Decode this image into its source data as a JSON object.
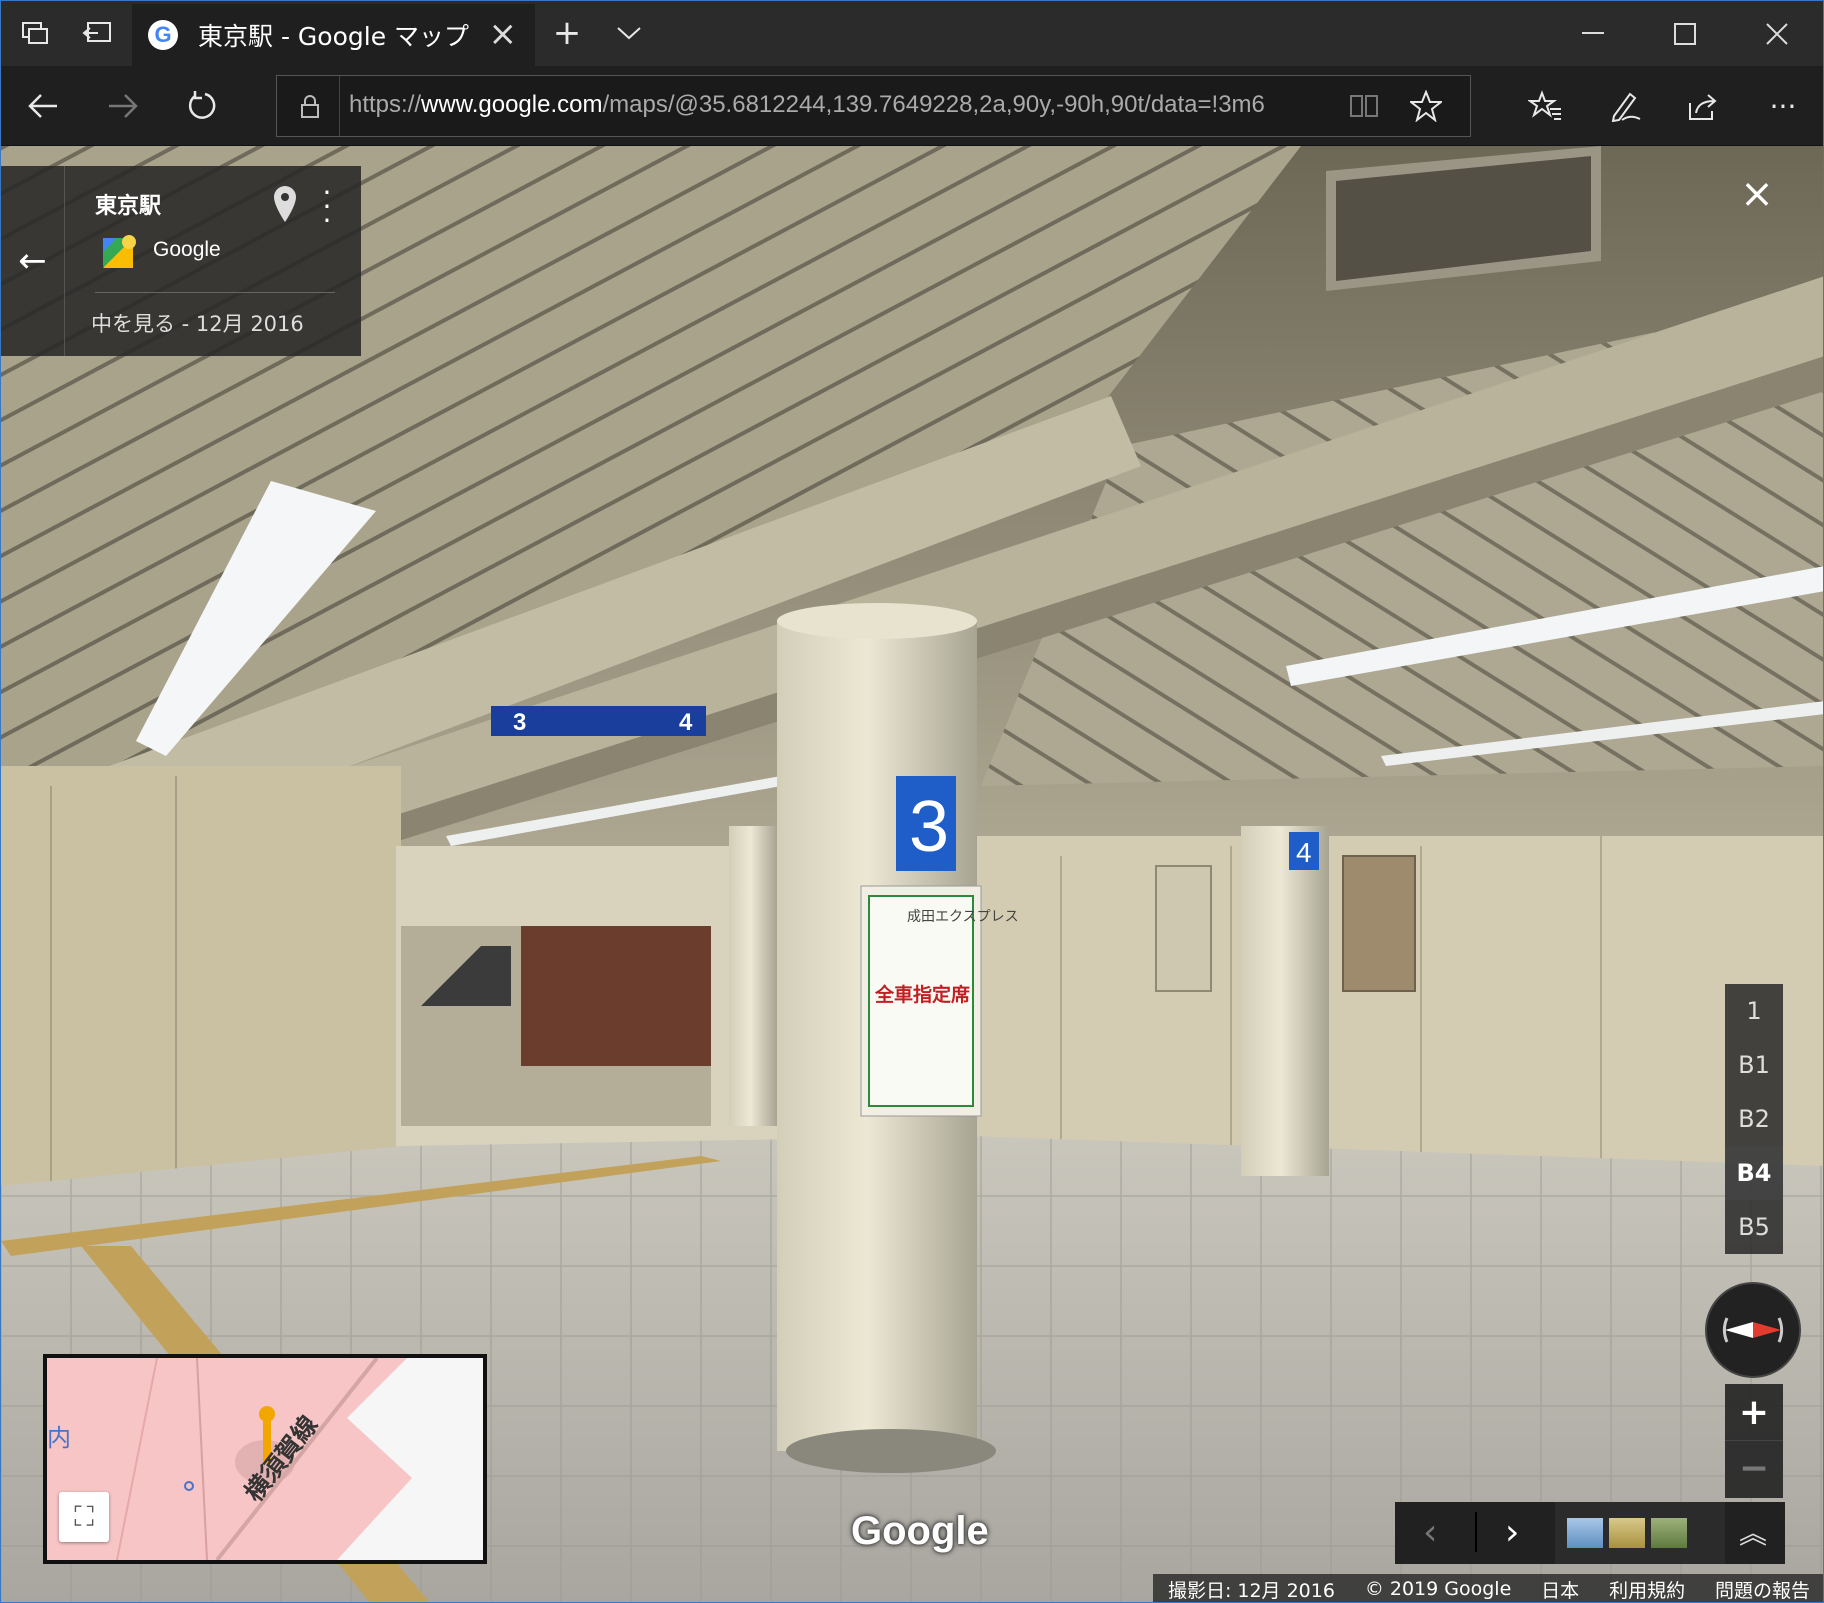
{
  "tab": {
    "title": "東京駅 - Google マップ"
  },
  "address": {
    "scheme": "https://",
    "host": "www.google.com",
    "path": "/maps/@35.6812244,139.7649228,2a,90y,-90h,90t/data=!3m6"
  },
  "card": {
    "title": "東京駅",
    "source": "Google",
    "date": "中を見る - 12月 2016"
  },
  "floors": [
    "1",
    "B1",
    "B2",
    "B4",
    "B5"
  ],
  "active_floor": "B4",
  "zoom": {
    "in": "+",
    "out": "−"
  },
  "minimap": {
    "kanji": "内",
    "rail_label": "横須賀線"
  },
  "logo": "Google",
  "footer": {
    "date": "撮影日: 12月 2016",
    "copyright": "© 2019 Google",
    "region": "日本",
    "terms": "利用規約",
    "report": "問題の報告"
  },
  "scene": {
    "pillar_3": "3",
    "pillar_4": "4",
    "sign_left": "3",
    "sign_right": "4",
    "poster_title": "全車指定席",
    "poster_top": "成田エクスプレス"
  },
  "colors": {
    "titlebar": "#2b2b2b",
    "window_border": "#3b78c4",
    "pillar_sign": "#1f5ec9",
    "minimap_pink": "#f7c5c5"
  }
}
